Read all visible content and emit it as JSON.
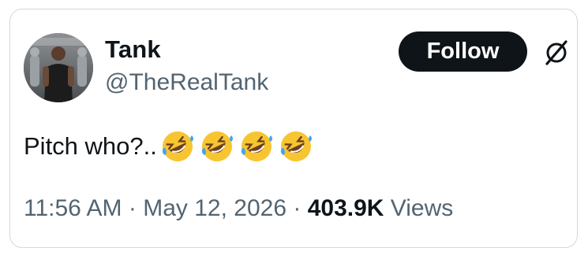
{
  "tweet": {
    "author": {
      "name": "Tank",
      "handle": "@TheRealTank",
      "avatar_icon": "profile-photo"
    },
    "follow_label": "Follow",
    "logo_icon": "x-logo-icon",
    "text": "Pitch who?..",
    "emojis": [
      "rolling-on-floor-laughing-emoji",
      "rolling-on-floor-laughing-emoji",
      "rolling-on-floor-laughing-emoji",
      "rolling-on-floor-laughing-emoji"
    ],
    "time": "11:56 AM",
    "separator": "·",
    "date": "May 12, 2026",
    "views_count": "403.9K",
    "views_label": "Views"
  },
  "colors": {
    "text_primary": "#0f1419",
    "text_secondary": "#536471",
    "follow_bg": "#0f1419",
    "border": "#cfd9de"
  }
}
